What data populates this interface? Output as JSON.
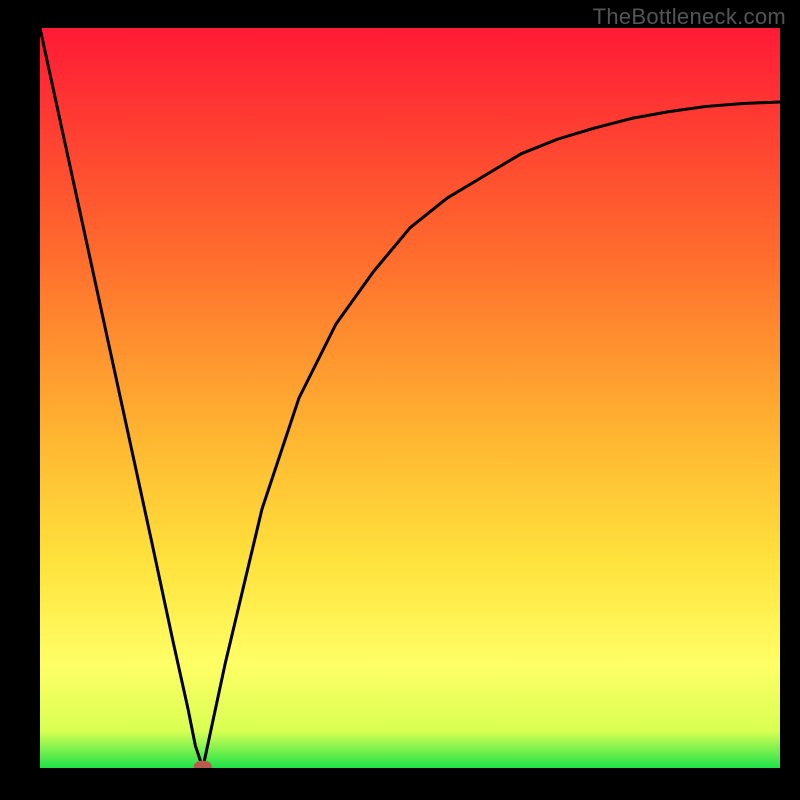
{
  "watermark": "TheBottleneck.com",
  "chart_data": {
    "type": "line",
    "title": "",
    "xlabel": "",
    "ylabel": "",
    "xlim": [
      0,
      100
    ],
    "ylim": [
      0,
      100
    ],
    "grid": false,
    "legend": false,
    "background_gradient": [
      "#ff1a36",
      "#ff8a2a",
      "#ffd93b",
      "#ffff66",
      "#1fe24a"
    ],
    "series": [
      {
        "name": "bottleneck-curve",
        "x": [
          0,
          5,
          10,
          15,
          18,
          20,
          21,
          22,
          25,
          30,
          35,
          40,
          45,
          50,
          55,
          60,
          65,
          70,
          75,
          80,
          85,
          90,
          95,
          100
        ],
        "values": [
          100,
          77,
          54,
          31,
          17,
          8,
          3,
          0,
          14,
          35,
          50,
          60,
          67,
          73,
          77,
          80,
          83,
          85,
          86.5,
          87.8,
          88.7,
          89.4,
          89.8,
          90
        ],
        "color": "#000000",
        "linewidth": 2
      }
    ],
    "markers": [
      {
        "name": "optimal-point",
        "x": 22,
        "y": 0.2,
        "shape": "ellipse",
        "color": "#bb5a4f"
      }
    ]
  }
}
